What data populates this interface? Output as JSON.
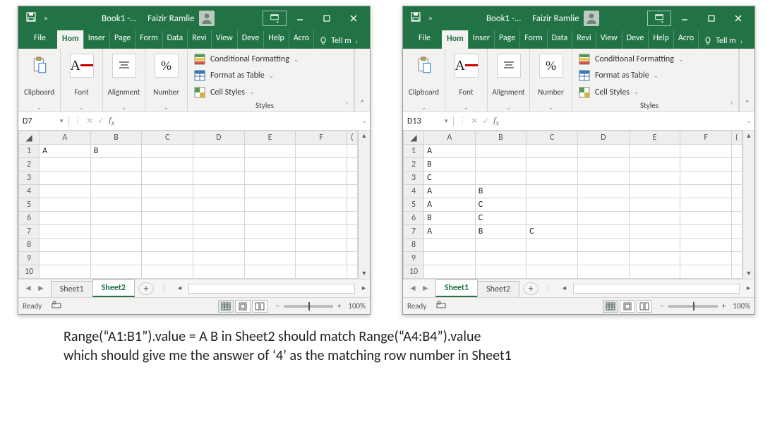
{
  "titlebar": {
    "book": "Book1  -…",
    "user": "Faizir Ramlie"
  },
  "tabs": {
    "file": "File",
    "items": [
      "Hom",
      "Inser",
      "Page",
      "Form",
      "Data",
      "Revi",
      "View",
      "Deve",
      "Help",
      "Acro"
    ],
    "active_index": 0,
    "tell": "Tell m"
  },
  "ribbon_groups": {
    "clipboard": "Clipboard",
    "font": "Font",
    "alignment": "Alignment",
    "number": "Number",
    "number_symbol": "%",
    "cond_format": "Conditional Formatting",
    "format_table": "Format as Table",
    "cell_styles": "Cell Styles",
    "styles": "Styles"
  },
  "left": {
    "namebox": "D7",
    "sheets": [
      "Sheet1",
      "Sheet2"
    ],
    "active_sheet": 1,
    "columns": [
      "A",
      "B",
      "C",
      "D",
      "E",
      "F"
    ],
    "rows": 10,
    "cells": {
      "1": {
        "A": "A",
        "B": "B"
      }
    }
  },
  "right": {
    "namebox": "D13",
    "sheets": [
      "Sheet1",
      "Sheet2"
    ],
    "active_sheet": 0,
    "columns": [
      "A",
      "B",
      "C",
      "D",
      "E",
      "F"
    ],
    "rows": 10,
    "cells": {
      "1": {
        "A": "A"
      },
      "2": {
        "A": "B"
      },
      "3": {
        "A": "C"
      },
      "4": {
        "A": "A",
        "B": "B"
      },
      "5": {
        "A": "A",
        "B": "C"
      },
      "6": {
        "A": "B",
        "B": "C"
      },
      "7": {
        "A": "A",
        "B": "B",
        "C": "C"
      }
    }
  },
  "statusbar": {
    "ready": "Ready",
    "zoom": "100%"
  },
  "caption": {
    "line1": "Range(“A1:B1”).value = A B in Sheet2 should match Range(“A4:B4”).value",
    "line2": "which should give me the answer of ‘4’ as the matching row number in Sheet1"
  }
}
